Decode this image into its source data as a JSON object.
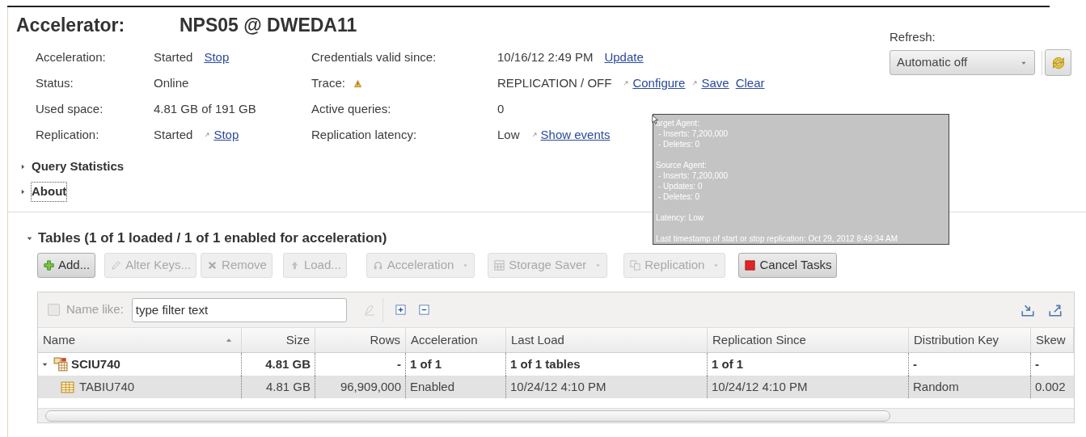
{
  "accelerator": {
    "label": "Accelerator:",
    "name": "NPS05 @ DWEDA11"
  },
  "refresh": {
    "label": "Refresh:",
    "value": "Automatic off"
  },
  "property_rows": [
    {
      "cells": [
        {
          "label": "Acceleration:",
          "value": "Started",
          "warning": false,
          "links": [
            {
              "text": "Stop",
              "external": false
            }
          ]
        },
        {
          "label": "Credentials valid since:",
          "value": "10/16/12 2:49 PM",
          "warning": false,
          "links": [
            {
              "text": "Update",
              "external": false
            }
          ]
        }
      ]
    },
    {
      "cells": [
        {
          "label": "Status:",
          "value": "Online",
          "warning": false
        },
        {
          "label": "Trace:",
          "value": "REPLICATION / OFF",
          "warning": true,
          "links": [
            {
              "text": "Configure",
              "external": true
            },
            {
              "text": "Save",
              "external": true
            },
            {
              "text": "Clear",
              "external": false
            }
          ]
        }
      ]
    },
    {
      "cells": [
        {
          "label": "Used space:",
          "value": "4.81 GB of 191 GB",
          "warning": false
        },
        {
          "label": "Active queries:",
          "value": "0",
          "warning": false
        }
      ]
    },
    {
      "cells": [
        {
          "label": "Replication:",
          "value": "Started",
          "warning": false,
          "links": [
            {
              "text": "Stop",
              "external": true
            }
          ]
        },
        {
          "label": "Replication latency:",
          "value": "Low",
          "warning": false,
          "links": [
            {
              "text": "Show events",
              "external": true
            }
          ]
        }
      ]
    }
  ],
  "sections": [
    {
      "label": "Query Statistics",
      "expanded": false,
      "focused": false
    },
    {
      "label": "About",
      "expanded": false,
      "focused": true
    }
  ],
  "tables_section": {
    "label": "Tables (1 of 1 loaded / 1 of 1 enabled for acceleration)",
    "expanded": true
  },
  "toolbar": [
    {
      "label": "Add...",
      "disabled": false,
      "dropdown": false
    },
    {
      "label": "Alter Keys...",
      "disabled": true,
      "dropdown": false
    },
    {
      "label": "Remove",
      "disabled": true,
      "dropdown": false
    },
    {
      "label": "Load...",
      "disabled": true,
      "dropdown": false
    },
    {
      "label": "Acceleration",
      "disabled": true,
      "dropdown": true
    },
    {
      "label": "Storage Saver",
      "disabled": true,
      "dropdown": true
    },
    {
      "label": "Replication",
      "disabled": true,
      "dropdown": true
    },
    {
      "label": "Cancel Tasks",
      "disabled": false,
      "dropdown": false
    }
  ],
  "filter": {
    "checked": false,
    "label": "Name like:",
    "placeholder": "type filter text"
  },
  "table": {
    "columns": [
      {
        "label": "Name",
        "sorted": true
      },
      {
        "label": "Size",
        "sorted": false
      },
      {
        "label": "Rows",
        "sorted": false
      },
      {
        "label": "Acceleration",
        "sorted": false
      },
      {
        "label": "Last Load",
        "sorted": false
      },
      {
        "label": "Replication Since",
        "sorted": false
      },
      {
        "label": "Distribution Key",
        "sorted": false
      },
      {
        "label": "Skew",
        "sorted": false
      }
    ],
    "rows": [
      {
        "kind": "schema",
        "expanded": true,
        "selected": false,
        "cells": [
          "SCIU740",
          "4.81 GB",
          "-",
          "1 of 1",
          "1 of 1 tables",
          "1 of 1",
          "-",
          "-"
        ],
        "children": [
          {
            "kind": "table",
            "selected": true,
            "cells": [
              "TABIU740",
              "4.81 GB",
              "96,909,000",
              "Enabled",
              "10/24/12 4:10 PM",
              "10/24/12 4:10 PM",
              "Random",
              "0.002"
            ]
          }
        ]
      }
    ]
  },
  "tooltip": {
    "paragraphs": [
      [
        "arget Agent:",
        "- Inserts: 7,200,000",
        "- Deletes: 0"
      ],
      [
        "Source Agent:",
        "- Inserts: 7,200,000",
        "- Updates: 0",
        "- Deletes: 0"
      ],
      [
        "Latency: Low"
      ],
      [
        "Last timestamp of start or stop replication: Oct 29, 2012 8:49:34 AM"
      ]
    ]
  }
}
